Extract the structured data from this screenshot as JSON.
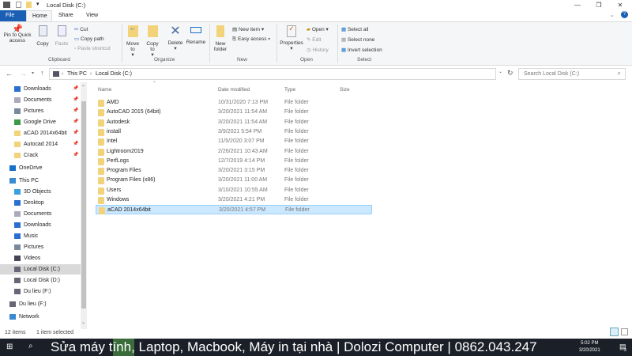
{
  "window": {
    "title": "Local Disk (C:)",
    "controls": [
      "—",
      "❐",
      "✕"
    ]
  },
  "tabs": [
    "File",
    "Home",
    "Share",
    "View"
  ],
  "ribbon": {
    "clipboard": {
      "label": "Clipboard",
      "pin": "Pin to Quick access",
      "copy": "Copy",
      "paste": "Paste",
      "cut": "Cut",
      "copy_path": "Copy path",
      "paste_shortcut": "Paste shortcut"
    },
    "organize": {
      "label": "Organize",
      "move_to": "Move to",
      "copy_to": "Copy to",
      "delete": "Delete",
      "rename": "Rename"
    },
    "new": {
      "label": "New",
      "new_folder": "New folder",
      "new_item": "New item",
      "easy_access": "Easy access"
    },
    "open": {
      "label": "Open",
      "properties": "Properties",
      "open": "Open",
      "edit": "Edit",
      "history": "History"
    },
    "select": {
      "label": "Select",
      "select_all": "Select all",
      "select_none": "Select none",
      "invert": "Invert selection"
    }
  },
  "address": {
    "crumbs": [
      "This PC",
      "Local Disk (C:)"
    ],
    "search_placeholder": "Search Local Disk (C:)"
  },
  "sidebar": [
    {
      "label": "Downloads",
      "icon": "download-icon",
      "pinned": true,
      "indent": 1
    },
    {
      "label": "Documents",
      "icon": "document-icon",
      "pinned": true,
      "indent": 1
    },
    {
      "label": "Pictures",
      "icon": "pictures-icon",
      "pinned": true,
      "indent": 1
    },
    {
      "label": "Google Drive",
      "icon": "google-drive-icon",
      "pinned": true,
      "indent": 1
    },
    {
      "label": "aCAD 2014x64bit",
      "icon": "folder-icon",
      "pinned": true,
      "indent": 1
    },
    {
      "label": "Autocad 2014",
      "icon": "folder-icon",
      "pinned": true,
      "indent": 1
    },
    {
      "label": "Crack",
      "icon": "folder-icon",
      "pinned": true,
      "indent": 1
    },
    {
      "label": "OneDrive",
      "icon": "onedrive-icon",
      "indent": 0,
      "gap": true
    },
    {
      "label": "This PC",
      "icon": "pc-icon",
      "indent": 0,
      "gap": true
    },
    {
      "label": "3D Objects",
      "icon": "cube-icon",
      "indent": 1
    },
    {
      "label": "Desktop",
      "icon": "desktop-icon",
      "indent": 1
    },
    {
      "label": "Documents",
      "icon": "document-icon",
      "indent": 1
    },
    {
      "label": "Downloads",
      "icon": "download-icon",
      "indent": 1
    },
    {
      "label": "Music",
      "icon": "music-icon",
      "indent": 1
    },
    {
      "label": "Pictures",
      "icon": "pictures-icon",
      "indent": 1
    },
    {
      "label": "Videos",
      "icon": "video-icon",
      "indent": 1
    },
    {
      "label": "Local Disk (C:)",
      "icon": "drive-icon",
      "indent": 1,
      "selected": true
    },
    {
      "label": "Local Disk (D:)",
      "icon": "drive-icon",
      "indent": 1
    },
    {
      "label": "Du lieu (F:)",
      "icon": "drive-icon",
      "indent": 1
    },
    {
      "label": "Du lieu (F:)",
      "icon": "drive-icon",
      "indent": 0,
      "gap": true
    },
    {
      "label": "Network",
      "icon": "network-icon",
      "indent": 0,
      "gap": true
    }
  ],
  "columns": [
    "Name",
    "Date modified",
    "Type",
    "Size"
  ],
  "files": [
    {
      "name": "AMD",
      "date": "10/31/2020 7:13 PM",
      "type": "File folder"
    },
    {
      "name": "AutoCAD 2015 (64bit)",
      "date": "3/20/2021 11:54 AM",
      "type": "File folder"
    },
    {
      "name": "Autodesk",
      "date": "3/20/2021 11:54 AM",
      "type": "File folder"
    },
    {
      "name": "install",
      "date": "3/9/2021 5:54 PM",
      "type": "File folder"
    },
    {
      "name": "Intel",
      "date": "11/5/2020 3:07 PM",
      "type": "File folder"
    },
    {
      "name": "Lightroom2019",
      "date": "2/26/2021 10:43 AM",
      "type": "File folder"
    },
    {
      "name": "PerfLogs",
      "date": "12/7/2019 4:14 PM",
      "type": "File folder"
    },
    {
      "name": "Program Files",
      "date": "3/20/2021 3:15 PM",
      "type": "File folder"
    },
    {
      "name": "Program Files (x86)",
      "date": "3/20/2021 11:00 AM",
      "type": "File folder"
    },
    {
      "name": "Users",
      "date": "3/10/2021 10:55 AM",
      "type": "File folder"
    },
    {
      "name": "Windows",
      "date": "3/20/2021 4:21 PM",
      "type": "File folder"
    },
    {
      "name": "aCAD 2014x64bit",
      "date": "3/20/2021 4:57 PM",
      "type": "File folder",
      "selected": true
    }
  ],
  "status": {
    "items": "12 items",
    "selected": "1 item selected"
  },
  "taskbar": {
    "overlay": "Sửa máy tính, Laptop, Macbook, Máy in tại nhà | Dolozi Computer | 0862.043.247",
    "time": "5:02 PM",
    "date": "3/20/2021",
    "notifications": "3"
  },
  "colors": {
    "accent": "#1a5fb4",
    "selection": "#cce8ff",
    "folder": "#f3d37a"
  }
}
